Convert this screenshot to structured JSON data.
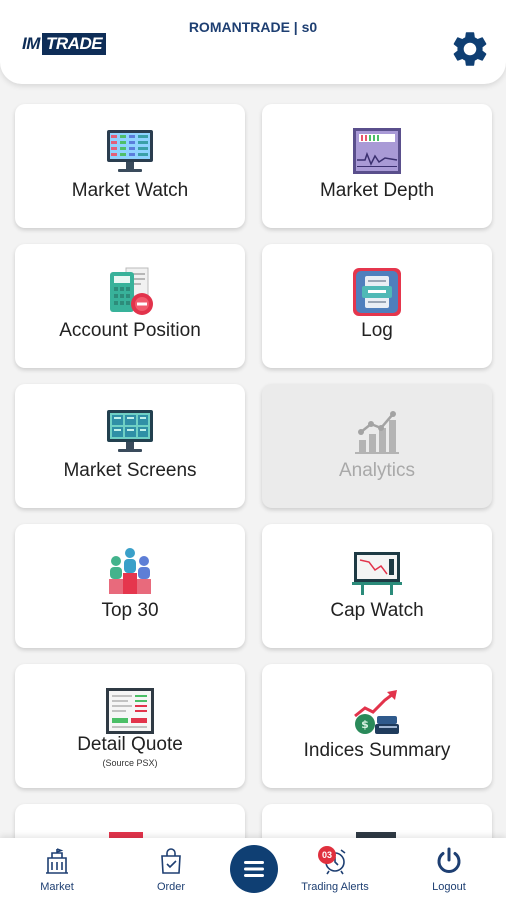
{
  "app": {
    "logo_text": "IMTRADE",
    "title": "ROMANTRADE | s0",
    "settings_icon": "gear-icon"
  },
  "colors": {
    "brand": "#0f3f73",
    "title": "#1e3f72",
    "card_bg": "#ffffff",
    "card_disabled_bg": "#ebebeb",
    "badge": "#e0303e"
  },
  "menu": [
    {
      "label": "Market Watch",
      "icon": "monitor-grid-icon",
      "enabled": true
    },
    {
      "label": "Market Depth",
      "icon": "depth-chart-icon",
      "enabled": true
    },
    {
      "label": "Account Position",
      "icon": "calculator-receipt-icon",
      "enabled": true
    },
    {
      "label": "Log",
      "icon": "log-file-icon",
      "enabled": true
    },
    {
      "label": "Market Screens",
      "icon": "monitor-screens-icon",
      "enabled": true
    },
    {
      "label": "Analytics",
      "icon": "analytics-bars-icon",
      "enabled": false
    },
    {
      "label": "Top 30",
      "icon": "people-podium-icon",
      "enabled": true
    },
    {
      "label": "Cap Watch",
      "icon": "presentation-board-icon",
      "enabled": true
    },
    {
      "label": "Detail Quote",
      "sublabel": "(Source PSX)",
      "icon": "quote-document-icon",
      "enabled": true
    },
    {
      "label": "Indices Summary",
      "icon": "money-growth-icon",
      "enabled": true
    }
  ],
  "bottom_nav": {
    "market": {
      "label": "Market",
      "icon": "building-icon"
    },
    "order": {
      "label": "Order",
      "icon": "shopping-bag-icon"
    },
    "menu": {
      "icon": "hamburger-menu-icon"
    },
    "alerts": {
      "label": "Trading Alerts",
      "icon": "alarm-clock-icon",
      "badge": "03"
    },
    "logout": {
      "label": "Logout",
      "icon": "power-icon"
    }
  }
}
